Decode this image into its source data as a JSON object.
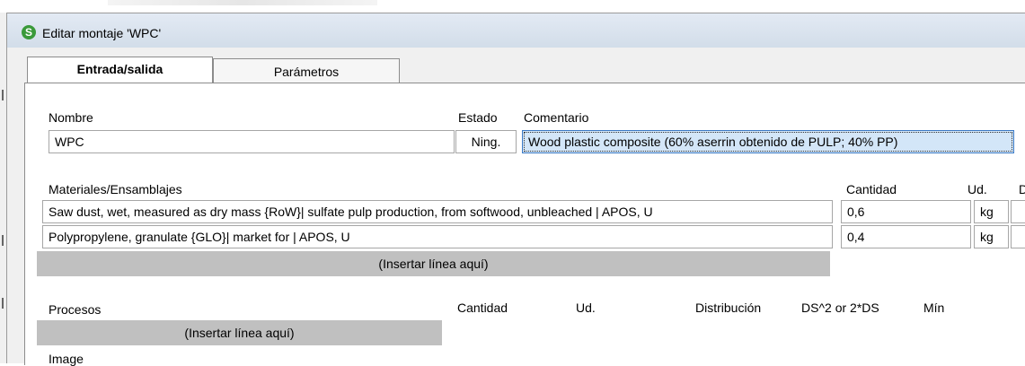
{
  "window": {
    "title": "Editar montaje 'WPC'",
    "icon_letter": "S"
  },
  "tabs": [
    {
      "label": "Entrada/salida",
      "active": true
    },
    {
      "label": "Parámetros",
      "active": false
    }
  ],
  "header_fields": {
    "nombre_label": "Nombre",
    "nombre_value": "WPC",
    "estado_label": "Estado",
    "estado_value": "Ning.",
    "comentario_label": "Comentario",
    "comentario_value": "Wood plastic composite (60% aserrin obtenido de PULP; 40% PP)"
  },
  "materials": {
    "header": "Materiales/Ensamblajes",
    "columns": {
      "cantidad": "Cantidad",
      "unidad": "Ud.",
      "dist_partial": "D"
    },
    "rows": [
      {
        "name": "Saw dust, wet, measured as dry mass {RoW}| sulfate pulp production, from softwood, unbleached | APOS, U",
        "amount": "0,6",
        "unit": "kg"
      },
      {
        "name": "Polypropylene, granulate {GLO}| market for | APOS, U",
        "amount": "0,4",
        "unit": "kg"
      }
    ],
    "insert_label": "(Insertar línea aquí)"
  },
  "processes": {
    "header": "Procesos",
    "columns": {
      "cantidad": "Cantidad",
      "unidad": "Ud.",
      "distribucion": "Distribución",
      "ds": "DS^2 or 2*DS",
      "min": "Mín"
    },
    "insert_label": "(Insertar línea aquí)"
  },
  "image_label": "Image",
  "colors": {
    "titlebar": "#d9e3ef",
    "selected_field": "#d3e6f8",
    "insert_bar": "#c0c0c0",
    "icon_green": "#3a9a3a"
  }
}
